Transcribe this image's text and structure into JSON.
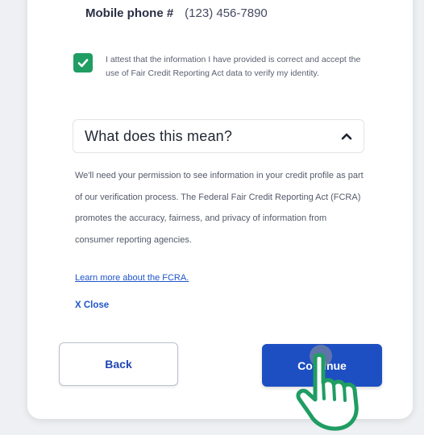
{
  "identity": {
    "phone_label": "Mobile phone #",
    "phone_value": "(123) 456-7890"
  },
  "consent": {
    "checked": true,
    "text": "I attest that the information I have provided is correct and accept the use of Fair Credit Reporting Act data to verify my identity."
  },
  "faq": {
    "title": "What does this mean?",
    "expanded": true,
    "body": "We'll need your permission to see information in your credit profile as part of our verification process. The Federal Fair Credit Reporting Act (FCRA) promotes the accuracy, fairness, and privacy of information from consumer reporting agencies.",
    "learn_more": "Learn more about the FCRA.",
    "close_label": "X Close"
  },
  "actions": {
    "back_label": "Back",
    "continue_label": "Continue"
  },
  "colors": {
    "primary": "#1d4fc3",
    "checkbox": "#1f9d63",
    "cursor_outline": "#1f9d63"
  },
  "icons": {
    "checkbox": "checkmark-icon",
    "accordion": "chevron-up-icon",
    "cursor": "hand-pointer-icon"
  }
}
